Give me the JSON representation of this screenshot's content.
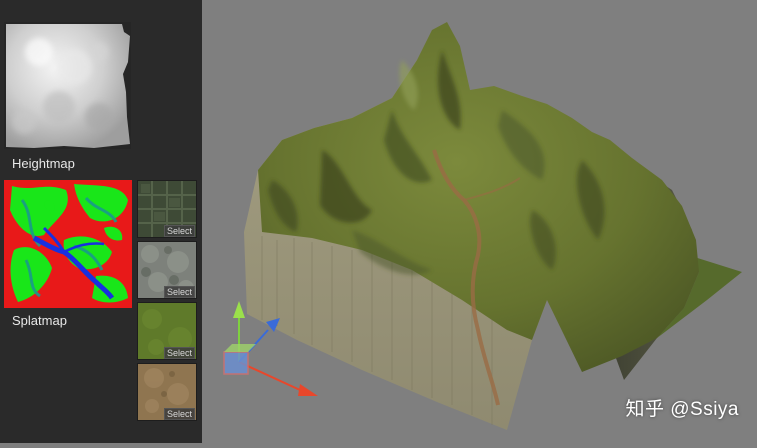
{
  "panel": {
    "heightmap_label": "Heightmap",
    "splatmap_label": "Splatmap",
    "layers": [
      {
        "name": "tiles",
        "select_label": "Select"
      },
      {
        "name": "rock",
        "select_label": "Select"
      },
      {
        "name": "grass",
        "select_label": "Select"
      },
      {
        "name": "dirt",
        "select_label": "Select"
      }
    ]
  },
  "scene": {
    "gizmo_axes": [
      "x",
      "y",
      "z"
    ]
  },
  "watermark": "知乎 @Ssiya",
  "colors": {
    "panel_bg": "#2a2a2a",
    "viewport_bg": "#7f7f7f",
    "gizmo_x": "#e8472b",
    "gizmo_y": "#7fd13f",
    "gizmo_z": "#3a6bd8"
  }
}
